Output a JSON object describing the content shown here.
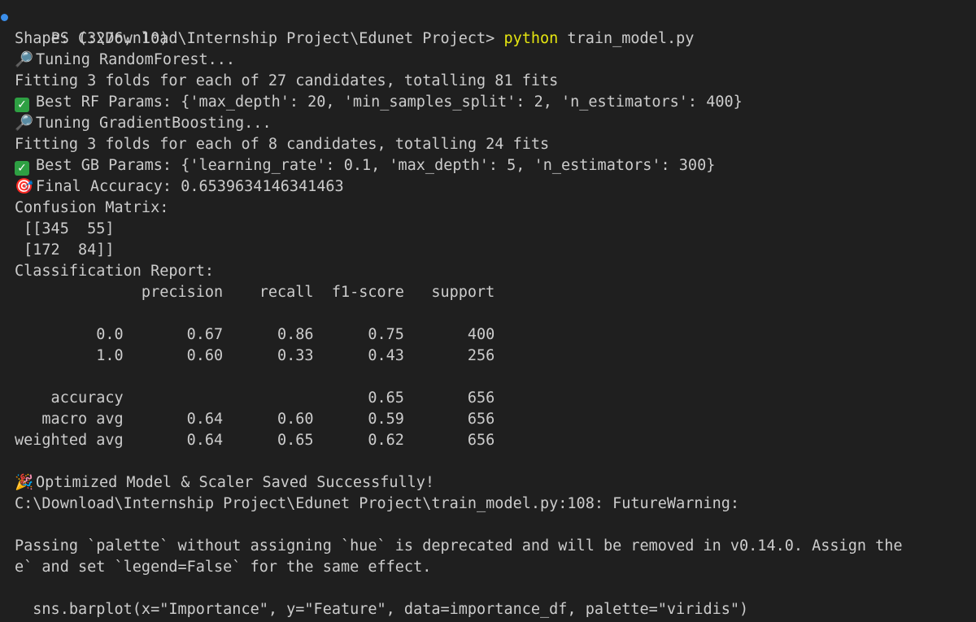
{
  "prompt": {
    "path": "PS C:\\Download\\Internship Project\\Edunet Project> ",
    "command": "python",
    "args": " train_model.py"
  },
  "lines": {
    "shape": "Shape: (3276, 10)",
    "tuning_rf": "Tuning RandomForest...",
    "fitting_rf": "Fitting 3 folds for each of 27 candidates, totalling 81 fits",
    "best_rf": "Best RF Params: {'max_depth': 20, 'min_samples_split': 2, 'n_estimators': 400}",
    "tuning_gb": "Tuning GradientBoosting...",
    "fitting_gb": "Fitting 3 folds for each of 8 candidates, totalling 24 fits",
    "best_gb": "Best GB Params: {'learning_rate': 0.1, 'max_depth': 5, 'n_estimators': 300}",
    "final_acc": "Final Accuracy: 0.6539634146341463",
    "cm_title": "Confusion Matrix:",
    "cm_row1": " [[345  55]",
    "cm_row2": " [172  84]]",
    "report_title": "Classification Report:",
    "report_header": "              precision    recall  f1-score   support",
    "report_blank1": "",
    "report_row0": "         0.0       0.67      0.86      0.75       400",
    "report_row1": "         1.0       0.60      0.33      0.43       256",
    "report_blank2": "",
    "report_accuracy": "    accuracy                           0.65       656",
    "report_macro": "   macro avg       0.64      0.60      0.59       656",
    "report_weighted": "weighted avg       0.64      0.65      0.62       656",
    "blank3": "",
    "saved": "Optimized Model & Scaler Saved Successfully!",
    "warning_path": "C:\\Download\\Internship Project\\Edunet Project\\train_model.py:108: FutureWarning:",
    "blank4": "",
    "warning_msg1": "Passing `palette` without assigning `hue` is deprecated and will be removed in v0.14.0. Assign the",
    "warning_msg2": "e` and set `legend=False` for the same effect.",
    "blank5": "",
    "code_line": "  sns.barplot(x=\"Importance\", y=\"Feature\", data=importance_df, palette=\"viridis\")"
  },
  "icons": {
    "search": "🔎",
    "check": "✓",
    "target": "🎯",
    "party": "🎉"
  },
  "colors": {
    "background": "#1f1f1f",
    "text": "#cccccc",
    "command": "#e5e510",
    "prompt_dot": "#3b8eea"
  }
}
